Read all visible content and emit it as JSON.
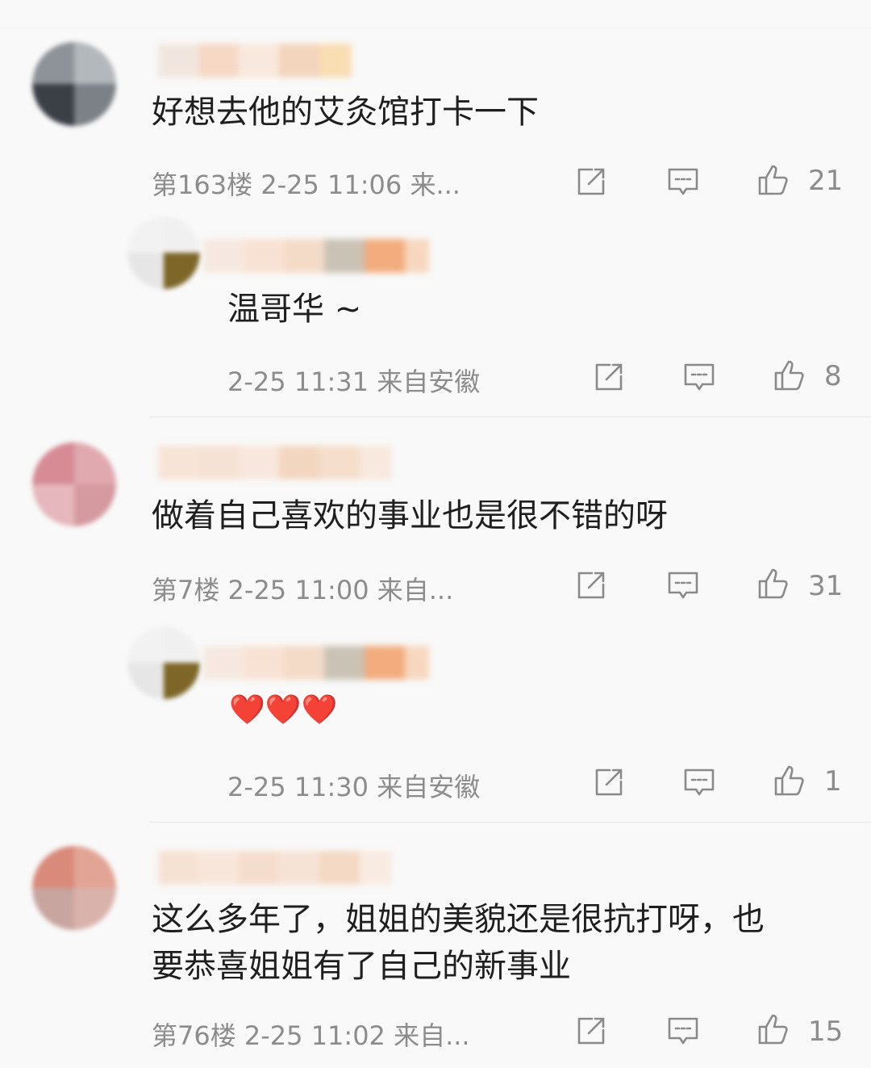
{
  "comments": [
    {
      "text": "好想去他的艾灸馆打卡一下",
      "meta": "第163楼 2-25 11:06 来...",
      "likes": "21",
      "reply": {
        "text": "温哥华 ~",
        "meta": "2-25 11:31 来自安徽",
        "likes": "8"
      }
    },
    {
      "text": "做着自己喜欢的事业也是很不错的呀",
      "meta": "第7楼 2-25 11:00 来自...",
      "likes": "31",
      "reply": {
        "text": "❤️❤️❤️",
        "meta": "2-25 11:30 来自安徽",
        "likes": "1"
      }
    },
    {
      "text_line1": "这么多年了，姐姐的美貌还是很抗打呀，也",
      "text_line2": "要恭喜姐姐有了自己的新事业",
      "meta": "第76楼 2-25 11:02 来自...",
      "likes": "15"
    }
  ],
  "icons": {
    "share": "share-icon",
    "comment": "comment-icon",
    "like": "thumbs-up-icon"
  },
  "colors": {
    "text": "#1f1f1f",
    "meta": "#8c8c8c",
    "icon": "#8a8a8a",
    "heart": "#e53935"
  }
}
